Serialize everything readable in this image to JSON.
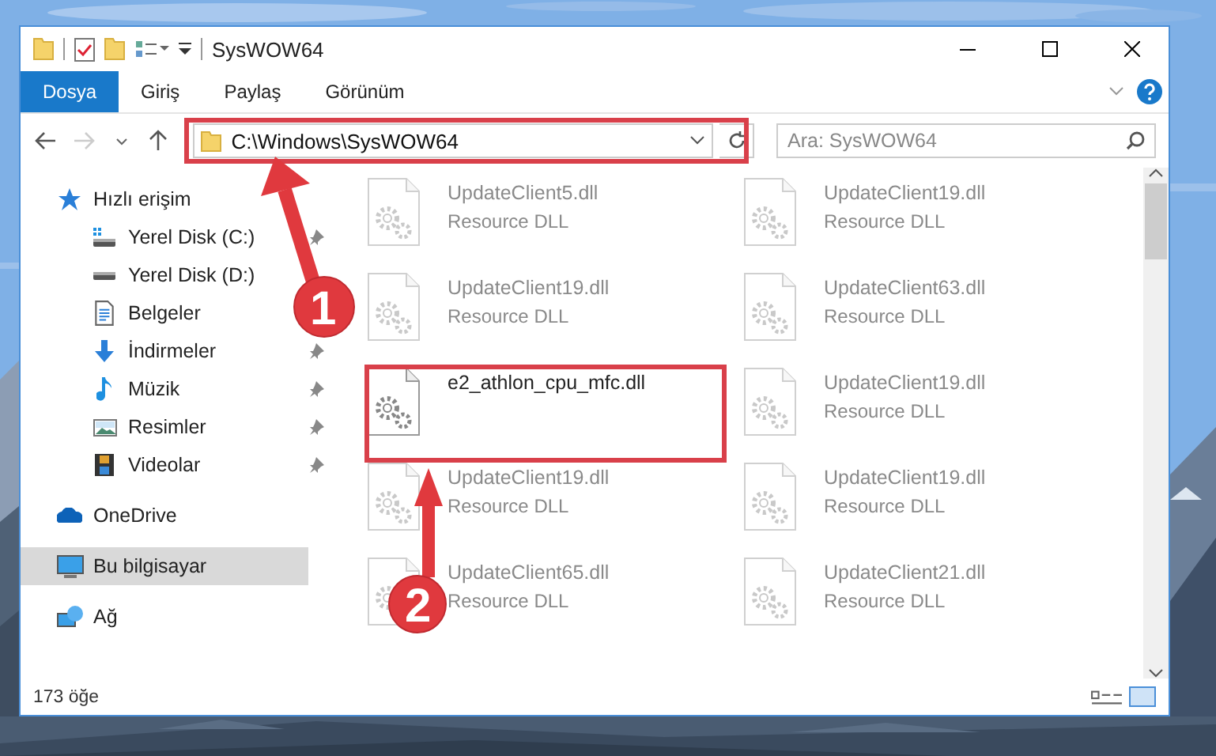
{
  "window": {
    "title": "SysWOW64"
  },
  "ribbon_tabs": [
    {
      "label": "Dosya",
      "selected": true
    },
    {
      "label": "Giriş",
      "selected": false
    },
    {
      "label": "Paylaş",
      "selected": false
    },
    {
      "label": "Görünüm",
      "selected": false
    }
  ],
  "address": {
    "path": "C:\\Windows\\SysWOW64"
  },
  "search": {
    "placeholder": "Ara: SysWOW64"
  },
  "sidebar": {
    "items": [
      {
        "label": "Hızlı erişim",
        "kind": "star",
        "selected": false,
        "children": [
          {
            "label": "Yerel Disk (C:)",
            "kind": "drive-c",
            "pinned": true,
            "selected": false
          },
          {
            "label": "Yerel Disk (D:)",
            "kind": "drive",
            "pinned": false,
            "selected": false
          },
          {
            "label": "Belgeler",
            "kind": "documents",
            "pinned": false,
            "selected": false
          },
          {
            "label": "İndirmeler",
            "kind": "download",
            "pinned": true,
            "selected": false
          },
          {
            "label": "Müzik",
            "kind": "music",
            "pinned": true,
            "selected": false
          },
          {
            "label": "Resimler",
            "kind": "pictures",
            "pinned": true,
            "selected": false
          },
          {
            "label": "Videolar",
            "kind": "videos",
            "pinned": true,
            "selected": false
          }
        ]
      },
      {
        "label": "OneDrive",
        "kind": "cloud",
        "selected": false
      },
      {
        "label": "Bu bilgisayar",
        "kind": "computer",
        "selected": true
      },
      {
        "label": "Ağ",
        "kind": "network",
        "selected": false
      }
    ]
  },
  "files": [
    {
      "name": "UpdateClient5.dll",
      "type": "Resource DLL",
      "blurred": true
    },
    {
      "name": "UpdateClient19.dll",
      "type": "Resource DLL",
      "blurred": true
    },
    {
      "name": "UpdateClient19.dll",
      "type": "Resource DLL",
      "blurred": true
    },
    {
      "name": "UpdateClient63.dll",
      "type": "Resource DLL",
      "blurred": true
    },
    {
      "name": "e2_athlon_cpu_mfc.dll",
      "blurred": false
    },
    {
      "name": "UpdateClient19.dll",
      "type": "Resource DLL",
      "blurred": true
    },
    {
      "name": "UpdateClient19.dll",
      "type": "Resource DLL",
      "blurred": true
    },
    {
      "name": "UpdateClient19.dll",
      "type": "Resource DLL",
      "blurred": true
    },
    {
      "name": "UpdateClient65.dll",
      "type": "Resource DLL",
      "blurred": true
    },
    {
      "name": "UpdateClient21.dll",
      "type": "Resource DLL",
      "blurred": true
    }
  ],
  "status_bar": {
    "item_count": "173 öğe"
  },
  "annotations": [
    {
      "label": "1"
    },
    {
      "label": "2"
    }
  ]
}
